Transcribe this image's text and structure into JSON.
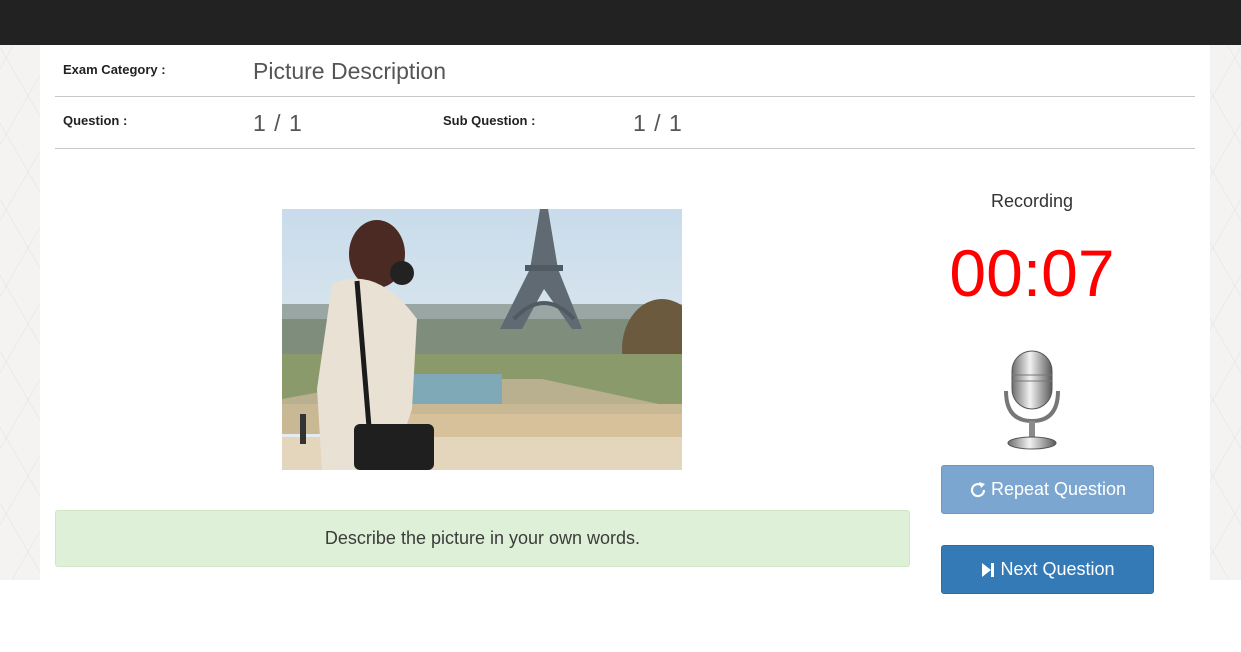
{
  "header": {
    "exam_category_label": "Exam Category :",
    "exam_category_value": "Picture Description",
    "question_label": "Question :",
    "question_value": "1 / 1",
    "sub_question_label": "Sub Question :",
    "sub_question_value": "1 / 1"
  },
  "main": {
    "instruction": "Describe the picture in your own words."
  },
  "recorder": {
    "status_label": "Recording",
    "timer": "00:07",
    "mic_icon": "microphone-icon"
  },
  "buttons": {
    "repeat_label": "Repeat Question",
    "repeat_icon": "refresh-icon",
    "next_label": "Next Question",
    "next_icon": "skip-forward-icon"
  },
  "colors": {
    "topbar": "#222222",
    "timer": "#ff0000",
    "repeat_button": "#7aa6d0",
    "next_button": "#337ab7",
    "instruction_bg": "#dff0d8"
  }
}
